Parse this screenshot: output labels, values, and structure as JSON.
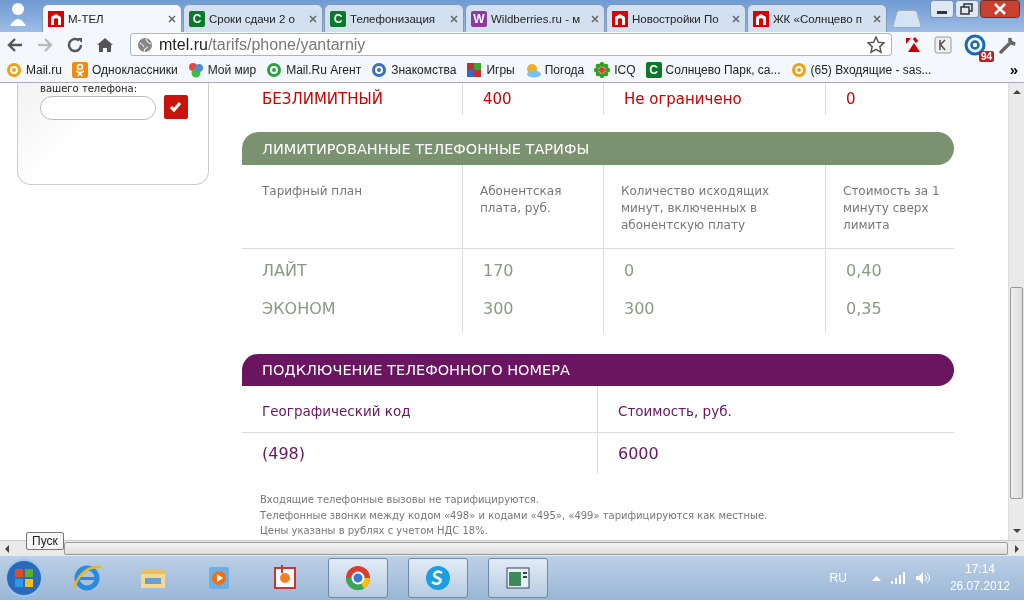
{
  "browser": {
    "tabs": [
      {
        "title": "М-ТЕЛ",
        "selected": true,
        "kind": "logo"
      },
      {
        "title": "Сроки сдачи 2 о",
        "selected": false,
        "kind": "letter",
        "letter": "С",
        "color": "#0a7a2a"
      },
      {
        "title": "Телефонизация",
        "selected": false,
        "kind": "letter",
        "letter": "С",
        "color": "#0a7a2a"
      },
      {
        "title": "Wildberries.ru - м",
        "selected": false,
        "kind": "letter",
        "letter": "W",
        "color": "#8a3aa0"
      },
      {
        "title": "Новостройки По",
        "selected": false,
        "kind": "logo"
      },
      {
        "title": "ЖК «Солнцево п",
        "selected": false,
        "kind": "logo"
      }
    ],
    "address": {
      "domain": "mtel.ru",
      "path": "/tarifs/phone/yantarniy"
    },
    "mail_badge": "94",
    "bookmarks": [
      {
        "label": "Mail.ru",
        "kind": "at",
        "color": "#f0a010"
      },
      {
        "label": "Одноклассники",
        "kind": "ok",
        "color": "#f08a10"
      },
      {
        "label": "Мой мир",
        "kind": "mir",
        "color": "#4a90d0"
      },
      {
        "label": "Mail.Ru Агент",
        "kind": "at",
        "color": "#2aa040"
      },
      {
        "label": "Знакомства",
        "kind": "at",
        "color": "#3a70c0"
      },
      {
        "label": "Игры",
        "kind": "games",
        "color": "#c03030"
      },
      {
        "label": "Погода",
        "kind": "weather",
        "color": "#f0b020"
      },
      {
        "label": "ICQ",
        "kind": "icq",
        "color": "#30a020"
      },
      {
        "label": "Солнцево Парк, са...",
        "kind": "letter",
        "letter": "С",
        "color": "#0a7a2a"
      },
      {
        "label": "(65) Входящие - sas...",
        "kind": "at",
        "color": "#f0a010"
      }
    ],
    "more": "»"
  },
  "page": {
    "sidebar": {
      "label": "вашего телефона:"
    },
    "unlimited_row": [
      "БЕЗЛИМИТНЫЙ",
      "400",
      "Не ограничено",
      "0"
    ],
    "limited": {
      "title": "ЛИМИТИРОВАННЫЕ ТЕЛЕФОННЫЕ ТАРИФЫ",
      "columns": [
        "Тарифный план",
        "Абонентская плата, руб.",
        "Количество исходящих минут, включенных в абонентскую плату",
        "Стоимость за 1 минуту сверх лимита"
      ],
      "rows": [
        [
          "ЛАЙТ",
          "170",
          "0",
          "0,40"
        ],
        [
          "ЭКОНОМ",
          "300",
          "300",
          "0,35"
        ]
      ]
    },
    "connection": {
      "title": "ПОДКЛЮЧЕНИЕ ТЕЛЕФОННОГО НОМЕРА",
      "columns": [
        "Географический код",
        "Стоимость, руб."
      ],
      "rows": [
        [
          "(498)",
          "6000"
        ]
      ]
    },
    "notes": [
      "Входящие телефонные вызовы не тарифицируются.",
      "Телефонные звонки между кодом «498» и кодами «495», «499» тарифицируются как местные.",
      "Цены указаны в рублях с учетом НДС 18%."
    ]
  },
  "tooltip": "Пуск",
  "taskbar": {
    "apps": [
      {
        "kind": "ie",
        "open": false
      },
      {
        "kind": "folder",
        "open": false
      },
      {
        "kind": "media",
        "open": false
      },
      {
        "kind": "photo",
        "open": false
      },
      {
        "kind": "chrome",
        "open": true
      },
      {
        "kind": "skype",
        "open": true
      },
      {
        "kind": "window",
        "open": true
      }
    ],
    "language": "RU",
    "time": "17:14",
    "date": "26.07.2012"
  }
}
